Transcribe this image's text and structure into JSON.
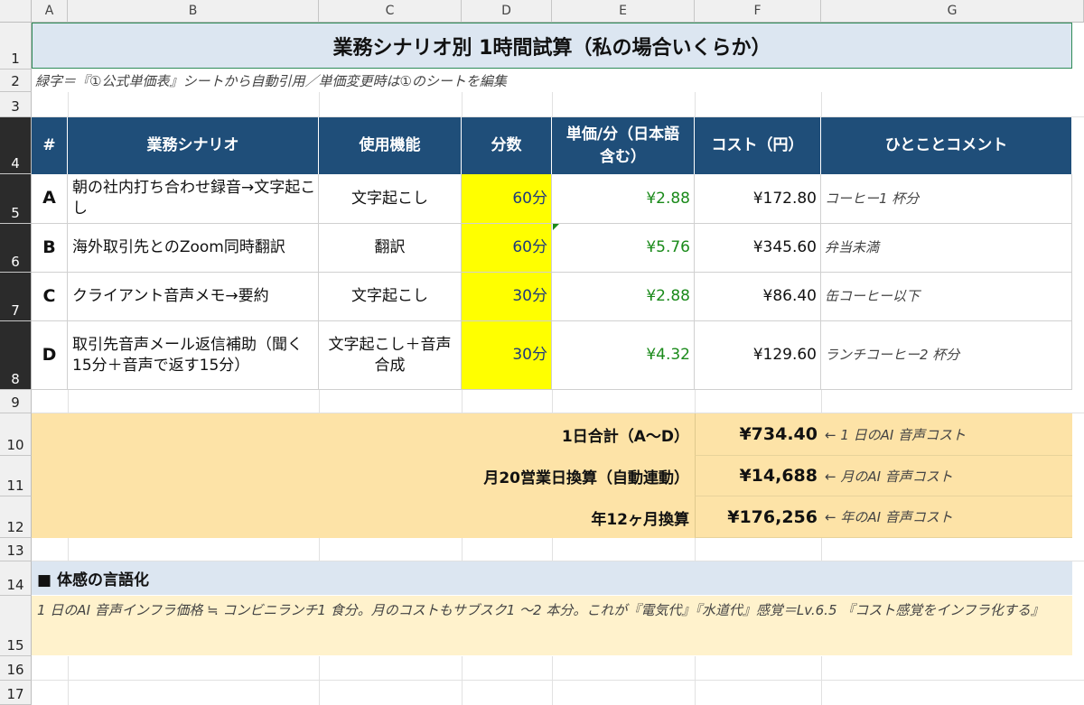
{
  "sheet": {
    "columns": [
      "A",
      "B",
      "C",
      "D",
      "E",
      "F",
      "G"
    ],
    "rows": [
      "1",
      "2",
      "3",
      "4",
      "5",
      "6",
      "7",
      "8",
      "9",
      "10",
      "11",
      "12",
      "13",
      "14",
      "15",
      "16",
      "17"
    ],
    "title": "業務シナリオ別 1時間試算（私の場合いくらか）",
    "note": "緑字＝『①公式単価表』シートから自動引用／単価変更時は①のシートを編集",
    "headers": {
      "num": "#",
      "scenario": "業務シナリオ",
      "feature": "使用機能",
      "minutes": "分数",
      "unit_price": "単価/分（日本語含む）",
      "cost": "コスト（円）",
      "comment": "ひとことコメント"
    },
    "items": [
      {
        "id": "A",
        "scenario": "朝の社内打ち合わせ録音→文字起こし",
        "feature": "文字起こし",
        "minutes": "60分",
        "unit_price": "¥2.88",
        "cost": "¥172.80",
        "comment": "コーヒー1 杯分"
      },
      {
        "id": "B",
        "scenario": "海外取引先とのZoom同時翻訳",
        "feature": "翻訳",
        "minutes": "60分",
        "unit_price": "¥5.76",
        "cost": "¥345.60",
        "comment": "弁当未満"
      },
      {
        "id": "C",
        "scenario": "クライアント音声メモ→要約",
        "feature": "文字起こし",
        "minutes": "30分",
        "unit_price": "¥2.88",
        "cost": "¥86.40",
        "comment": "缶コーヒー以下"
      },
      {
        "id": "D",
        "scenario": "取引先音声メール返信補助（聞く15分＋音声で返す15分）",
        "feature": "文字起こし＋音声合成",
        "minutes": "30分",
        "unit_price": "¥4.32",
        "cost": "¥129.60",
        "comment": "ランチコーヒー2 杯分"
      }
    ],
    "summary": [
      {
        "label": "1日合計（A〜D）",
        "value": "¥734.40",
        "note": "← 1 日のAI 音声コスト"
      },
      {
        "label": "月20営業日換算（自動連動）",
        "value": "¥14,688",
        "note": "← 月のAI 音声コスト"
      },
      {
        "label": "年12ヶ月換算",
        "value": "¥176,256",
        "note": "← 年のAI 音声コスト"
      }
    ],
    "section_title": "■ 体感の言語化",
    "section_text": "1 日のAI 音声インフラ価格 ≒ コンビニランチ1 食分。月のコストもサブスク1 〜2 本分。これが『電気代』『水道代』感覚＝Lv.6.5 『コスト感覚をインフラ化する』"
  }
}
